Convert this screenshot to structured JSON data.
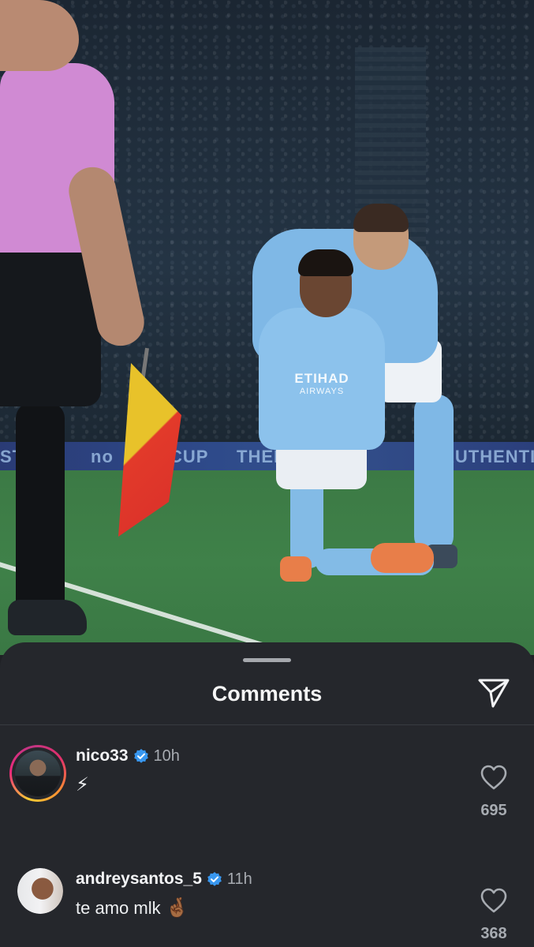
{
  "post": {
    "image_description_icon": "photo-background",
    "board_texts": [
      "STIC",
      "no",
      "CUP",
      "THEN",
      "AUTHENTIC"
    ],
    "sponsor_main": "ETIHAD",
    "sponsor_sub": "AIRWAYS"
  },
  "sheet": {
    "title": "Comments",
    "send_icon": "paper-plane-icon"
  },
  "comments": [
    {
      "username": "nico33",
      "verified": true,
      "time": "10h",
      "text": "⚡",
      "likes": "695",
      "avatar_story_ring": true
    },
    {
      "username": "andreysantos_5",
      "verified": true,
      "time": "11h",
      "text": "te amo mlk",
      "text_emoji": "🤞🏾",
      "likes": "368",
      "avatar_story_ring": false
    }
  ],
  "colors": {
    "sheet_bg": "#25272c",
    "verified_blue": "#3897f0",
    "muted_text": "#a7abb1",
    "story_ring": [
      "#f9ce34",
      "#ee2a7b",
      "#c13584"
    ]
  }
}
